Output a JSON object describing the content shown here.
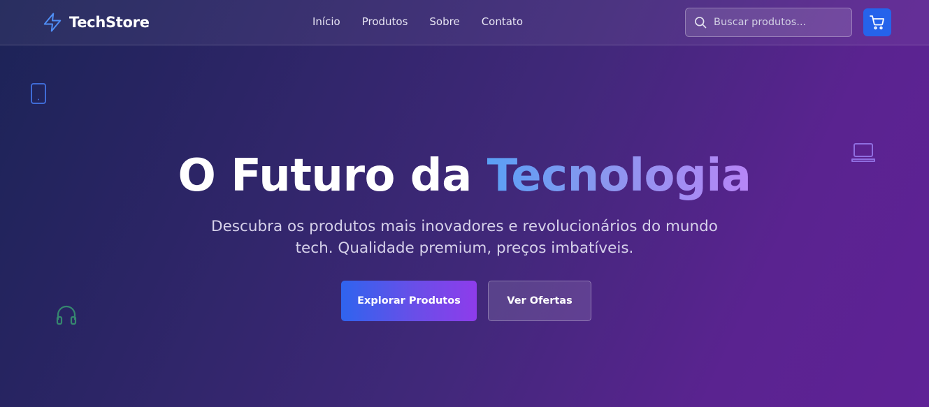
{
  "brand": {
    "name": "TechStore",
    "icon": "lightning-bolt-icon"
  },
  "nav": {
    "items": [
      {
        "label": "Início"
      },
      {
        "label": "Produtos"
      },
      {
        "label": "Sobre"
      },
      {
        "label": "Contato"
      }
    ]
  },
  "search": {
    "placeholder": "Buscar produtos...",
    "value": "",
    "icon": "search-icon"
  },
  "cart": {
    "icon": "shopping-cart-icon"
  },
  "hero": {
    "title_prefix": "O Futuro da ",
    "title_accent": "Tecnologia",
    "subtitle_line1": "Descubra os produtos mais inovadores e revolucionários do mundo",
    "subtitle_line2": "tech. Qualidade premium, preços imbatíveis.",
    "primary_button": "Explorar Produtos",
    "secondary_button": "Ver Ofertas"
  },
  "decorations": [
    "smartphone-icon",
    "laptop-icon",
    "headphones-icon"
  ],
  "colors": {
    "accent_blue": "#2563eb",
    "accent_purple": "#9333ea",
    "gradient_text_start": "#5aa0f5",
    "gradient_text_end": "#b785f6",
    "background_start": "#1c2357",
    "background_end": "#5f2296"
  }
}
